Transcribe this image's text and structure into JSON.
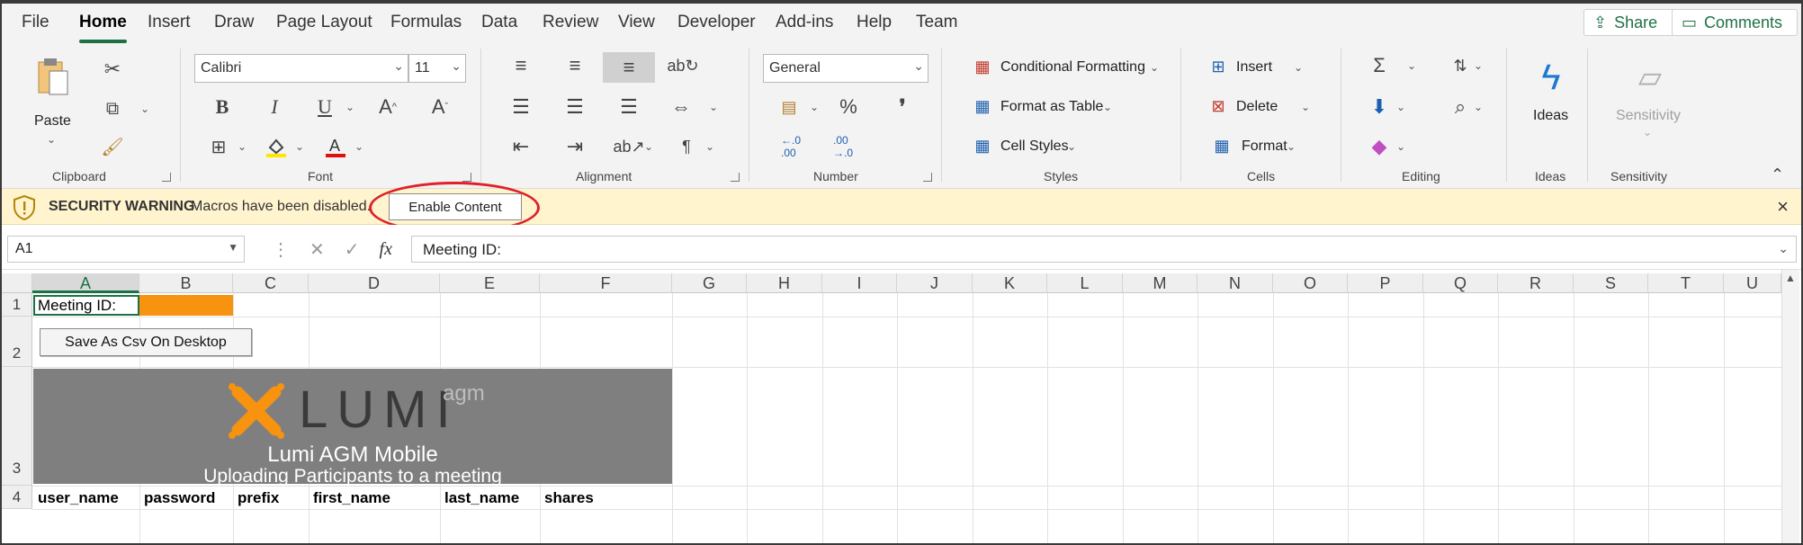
{
  "menu": {
    "items": [
      "File",
      "Home",
      "Insert",
      "Draw",
      "Page Layout",
      "Formulas",
      "Data",
      "Review",
      "View",
      "Developer",
      "Add-ins",
      "Help",
      "Team"
    ],
    "active": "Home",
    "share_label": "Share",
    "comments_label": "Comments"
  },
  "ribbon": {
    "clipboard": {
      "paste_label": "Paste",
      "group_label": "Clipboard"
    },
    "font": {
      "font_name": "Calibri",
      "font_size": "11",
      "group_label": "Font"
    },
    "alignment": {
      "group_label": "Alignment"
    },
    "number": {
      "format": "General",
      "percent": "%",
      "comma": "❜",
      "group_label": "Number"
    },
    "styles": {
      "conditional": "Conditional Formatting",
      "format_table": "Format as Table",
      "cell_styles": "Cell Styles",
      "group_label": "Styles"
    },
    "cells": {
      "insert": "Insert",
      "delete": "Delete",
      "format": "Format",
      "group_label": "Cells"
    },
    "editing": {
      "group_label": "Editing"
    },
    "ideas": {
      "label": "Ideas",
      "group_label": "Ideas"
    },
    "sensitivity": {
      "label": "Sensitivity",
      "group_label": "Sensitivity"
    }
  },
  "security": {
    "title": "SECURITY WARNING",
    "message": "Macros have been disabled.",
    "enable_label": "Enable Content"
  },
  "formula_bar": {
    "name_box": "A1",
    "formula": "Meeting ID:"
  },
  "grid": {
    "columns": [
      "A",
      "B",
      "C",
      "D",
      "E",
      "F",
      "G",
      "H",
      "I",
      "J",
      "K",
      "L",
      "M",
      "N",
      "O",
      "P",
      "Q",
      "R",
      "S",
      "T",
      "U"
    ],
    "rows": [
      "1",
      "2",
      "3",
      "4"
    ],
    "a1": "Meeting ID:",
    "csv_button": "Save As Csv On Desktop",
    "banner": {
      "logo": "LUMI",
      "logo_sub": "agm",
      "title": "Lumi AGM Mobile",
      "subtitle": "Uploading Participants to a meeting"
    },
    "headers": [
      "user_name",
      "password",
      "prefix",
      "first_name",
      "last_name",
      "shares"
    ]
  },
  "colors": {
    "accent": "#1e7145",
    "warning_bg": "#fff4ce",
    "highlight": "#f7930e",
    "annotation": "#e0202a"
  }
}
